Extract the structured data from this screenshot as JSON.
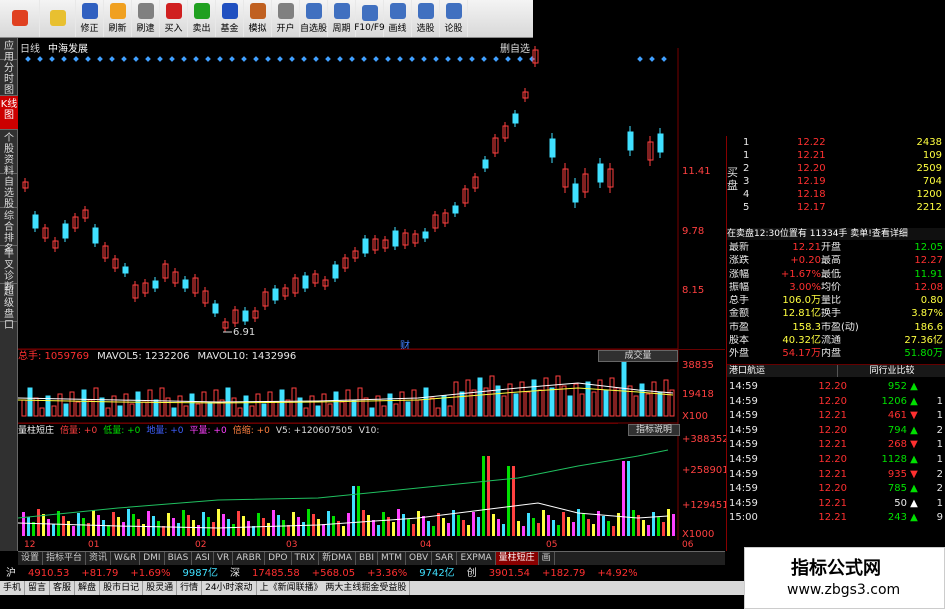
{
  "toolbar": {
    "buttons": [
      {
        "label": "",
        "icon": "app-logo-icon",
        "color": "#e04020"
      },
      {
        "label": "",
        "icon": "back-arrow-icon",
        "color": "#e8c030"
      },
      {
        "label": "修正",
        "icon": "fix-icon",
        "color": "#3060c0"
      },
      {
        "label": "刷新",
        "icon": "refresh-icon",
        "color": "#f0a020"
      },
      {
        "label": "刷逮",
        "icon": "clock-icon",
        "color": "#808080"
      },
      {
        "label": "买入",
        "icon": "buy-icon",
        "color": "#d02020"
      },
      {
        "label": "卖出",
        "icon": "sell-icon",
        "color": "#20a020"
      },
      {
        "label": "基金",
        "icon": "fund-icon",
        "color": "#2050c0"
      },
      {
        "label": "模拟",
        "icon": "hammer-icon",
        "color": "#c06020"
      },
      {
        "label": "开户",
        "icon": "lock-icon",
        "color": "#808080"
      },
      {
        "label": "自选股",
        "icon": "watchlist-icon",
        "color": "#4070c0"
      },
      {
        "label": "周期",
        "icon": "period-icon",
        "color": "#4070c0"
      },
      {
        "label": "F10/F9",
        "icon": "f10-icon",
        "color": "#4070c0"
      },
      {
        "label": "画线",
        "icon": "draw-line-icon",
        "color": "#4070c0"
      },
      {
        "label": "选股",
        "icon": "stock-pick-icon",
        "color": "#4070c0"
      },
      {
        "label": "论股",
        "icon": "forum-icon",
        "color": "#4070c0"
      }
    ]
  },
  "left_tabs": [
    "应用",
    "分时图",
    "K线图",
    "个股资料",
    "自选股",
    "综合排名",
    "牛叉诊断",
    "超级盘口"
  ],
  "chart": {
    "period_label": "日线",
    "stock_name": "中海发展",
    "top_right_label": "删自选",
    "price_axis": [
      "11.41",
      "9.78",
      "8.15"
    ],
    "low_marker": "6.91",
    "finance_marker": "财",
    "volume_header": {
      "label": "总手: 1059769",
      "ma5": "MAVOL5: 1232206",
      "ma10": "MAVOL10: 1432996",
      "button": "成交量"
    },
    "volume_axis": [
      "38835",
      "19418",
      "X100"
    ],
    "indicator_header": {
      "items": [
        "量柱短庄",
        "倍量: +0",
        "低量: +0",
        "地量: +0",
        "平量: +0",
        "倍缩: +0",
        "V5: +120607505",
        "V10:"
      ],
      "button": "指标说明"
    },
    "indicator_axis": [
      "+388352",
      "+258901",
      "+129451",
      "X1000"
    ],
    "x_axis": [
      "12",
      "01",
      "02",
      "03",
      "04",
      "05",
      "06"
    ]
  },
  "order_book": {
    "sell": [
      {
        "idx": "1",
        "price": "12.22",
        "vol": "2438"
      },
      {
        "idx": "1",
        "price": "12.21",
        "vol": "109"
      },
      {
        "idx": "2",
        "price": "12.20",
        "vol": "2509"
      },
      {
        "idx": "3",
        "price": "12.19",
        "vol": "704"
      },
      {
        "idx": "4",
        "price": "12.18",
        "vol": "1200"
      },
      {
        "idx": "5",
        "price": "12.17",
        "vol": "2212"
      }
    ],
    "side_label": "买盘",
    "status_line": "在卖盘12:30位置有 11334手 卖单!查看详细",
    "quote": [
      {
        "l": "最新",
        "v": "12.21",
        "l2": "开盘",
        "v2": "12.05"
      },
      {
        "l": "涨跌",
        "v": "+0.20",
        "l2": "最高",
        "v2": "12.27"
      },
      {
        "l": "涨幅",
        "v": "+1.67%",
        "l2": "最低",
        "v2": "11.91"
      },
      {
        "l": "振幅",
        "v": "3.00%",
        "l2": "均价",
        "v2": "12.08"
      },
      {
        "l": "总手",
        "v": "106.0万",
        "l2": "量比",
        "v2": "0.80"
      },
      {
        "l": "金额",
        "v": "12.81亿",
        "l2": "换手",
        "v2": "3.87%"
      },
      {
        "l": "市盈",
        "v": "158.3",
        "l2": "市盈(动)",
        "v2": "186.6"
      },
      {
        "l": "股本",
        "v": "40.32亿",
        "l2": "流通",
        "v2": "27.36亿"
      },
      {
        "l": "外盘",
        "v": "54.17万",
        "l2": "内盘",
        "v2": "51.80万"
      }
    ],
    "tabs": [
      "港口航运",
      "同行业比较"
    ],
    "trades": [
      {
        "t": "14:59",
        "p": "12.20",
        "v": "952",
        "d": "down",
        "n": ""
      },
      {
        "t": "14:59",
        "p": "12.20",
        "v": "1206",
        "d": "down",
        "n": "1"
      },
      {
        "t": "14:59",
        "p": "12.21",
        "v": "461",
        "d": "up",
        "n": "1"
      },
      {
        "t": "14:59",
        "p": "12.20",
        "v": "794",
        "d": "down",
        "n": "2"
      },
      {
        "t": "14:59",
        "p": "12.21",
        "v": "268",
        "d": "up",
        "n": "1"
      },
      {
        "t": "14:59",
        "p": "12.20",
        "v": "1128",
        "d": "down",
        "n": "1"
      },
      {
        "t": "14:59",
        "p": "12.21",
        "v": "935",
        "d": "up",
        "n": "2"
      },
      {
        "t": "14:59",
        "p": "12.20",
        "v": "785",
        "d": "down",
        "n": "2"
      },
      {
        "t": "14:59",
        "p": "12.21",
        "v": "50",
        "d": "neutral",
        "n": "1"
      },
      {
        "t": "15:00",
        "p": "12.21",
        "v": "243",
        "d": "down",
        "n": "9"
      }
    ]
  },
  "bottom_tabs": [
    "设置",
    "指标平台",
    "资讯",
    "W&R",
    "DMI",
    "BIAS",
    "ASI",
    "VR",
    "ARBR",
    "DPO",
    "TRIX",
    "新DMA",
    "BBI",
    "MTM",
    "OBV",
    "SAR",
    "EXPMA",
    "量柱短庄",
    "画"
  ],
  "ticker": [
    {
      "text": "沪",
      "c": "c-wht"
    },
    {
      "text": "4910.53",
      "c": "c-red"
    },
    {
      "text": "+81.79",
      "c": "c-red"
    },
    {
      "text": "+1.69%",
      "c": "c-red"
    },
    {
      "text": "9987亿",
      "c": "c-cyan"
    },
    {
      "text": "深",
      "c": "c-wht"
    },
    {
      "text": "17485.58",
      "c": "c-red"
    },
    {
      "text": "+568.05",
      "c": "c-red"
    },
    {
      "text": "+3.36%",
      "c": "c-red"
    },
    {
      "text": "9742亿",
      "c": "c-cyan"
    },
    {
      "text": "创",
      "c": "c-wht"
    },
    {
      "text": "3901.54",
      "c": "c-red"
    },
    {
      "text": "+182.79",
      "c": "c-red"
    },
    {
      "text": "+4.92%",
      "c": "c-red"
    }
  ],
  "status_bar": [
    "手机",
    "留言",
    "客服",
    "解盘",
    "股市日记",
    "股灵通",
    "行情",
    "24小时滚动",
    "上《新闻联播》 两大主线掘金受益股"
  ],
  "watermark": {
    "title": "指标公式网",
    "url": "www.zbgs3.com"
  }
}
